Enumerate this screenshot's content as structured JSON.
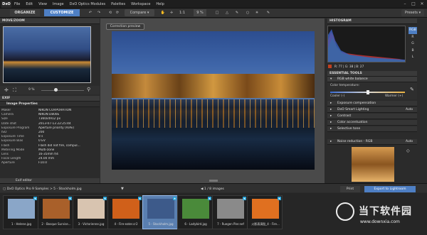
{
  "menu": {
    "logo": "DxO",
    "items": [
      "File",
      "Edit",
      "View",
      "Image",
      "DxO Optics Modules",
      "Palettes",
      "Workspace",
      "Help"
    ]
  },
  "toolbar": {
    "organize": "ORGANIZE",
    "customize": "CUSTOMIZE",
    "compare": "Compare",
    "zoom_ratio": "1:1",
    "zoom_pct": "9 %",
    "presets": "Presets"
  },
  "left": {
    "move_zoom_title": "MOVE/ZOOM",
    "zoom_value": "9 %",
    "exif_title": "EXIF",
    "props_title": "Image Properties",
    "props": [
      {
        "k": "Maker",
        "v": "NIKON CORPORATION"
      },
      {
        "k": "Camera",
        "v": "NIKON D800E"
      },
      {
        "k": "Size",
        "v": "7360x4912 px"
      },
      {
        "k": "Date shot",
        "v": "2013-07-13 22:25:44"
      },
      {
        "k": "Exposure Program",
        "v": "Aperture priority (A/Av)"
      },
      {
        "k": "ISO",
        "v": "200"
      },
      {
        "k": "Exposure Time",
        "v": "8 s"
      },
      {
        "k": "Exposure Bias",
        "v": "0 EV"
      },
      {
        "k": "Flash",
        "v": "Flash did not fire, compul..."
      },
      {
        "k": "Metering Mode",
        "v": "Multi-zone"
      },
      {
        "k": "Lens",
        "v": "16-35mm f/4"
      },
      {
        "k": "Focal Length",
        "v": "24.00 mm"
      },
      {
        "k": "Aperture",
        "v": "F10.0"
      }
    ],
    "exif_editor": "Exif editor"
  },
  "center": {
    "correction_preview": "Correction preview"
  },
  "right": {
    "histogram_title": "HISTOGRAM",
    "channels": [
      "RGB",
      "R",
      "G",
      "B",
      "L"
    ],
    "hist_values": "R: 77 | G: 38 | B: 27",
    "essential_title": "ESSENTIAL TOOLS",
    "wb_title": "RGB white balance",
    "color_temp": "Color temperature:",
    "cooler": "Cooler (-)",
    "warmer": "Warmer (+)",
    "tools": [
      {
        "label": "Exposure compensation",
        "auto": ""
      },
      {
        "label": "DxO Smart Lighting",
        "auto": "Auto"
      },
      {
        "label": "Contrast",
        "auto": ""
      },
      {
        "label": "Color accentuation",
        "auto": ""
      },
      {
        "label": "Selective tone",
        "auto": ""
      },
      {
        "label": "Noise reduction - RGB",
        "auto": "Auto"
      }
    ]
  },
  "bottom": {
    "breadcrumb": "DxO Optics Pro 9 Samples  >  5 - Stockholm.jpg",
    "count": "1 / 8  images",
    "print": "Print",
    "export": "Export to Lightroom"
  },
  "film": [
    {
      "label": "1 - Helene.jpg",
      "color": "#8aa6c8"
    },
    {
      "label": "2 - Bosque Survise...",
      "color": "#a9602a"
    },
    {
      "label": "3 - Victorienne.jpg",
      "color": "#d8c4b0"
    },
    {
      "label": "4 - Fire-eater.cr2",
      "color": "#d0601a"
    },
    {
      "label": "5 - Stockholm.jpg",
      "color": "#3d5a8a"
    },
    {
      "label": "6 - Ladybird.jpg",
      "color": "#4a8a3a"
    },
    {
      "label": "7 - Ruegen Pier.nef",
      "color": "#8a8a8a"
    },
    {
      "label": "火影表演股_4 - Fire...",
      "color": "#e07020"
    }
  ],
  "watermark": {
    "main": "当下软件园",
    "sub": "www.downxia.com"
  }
}
